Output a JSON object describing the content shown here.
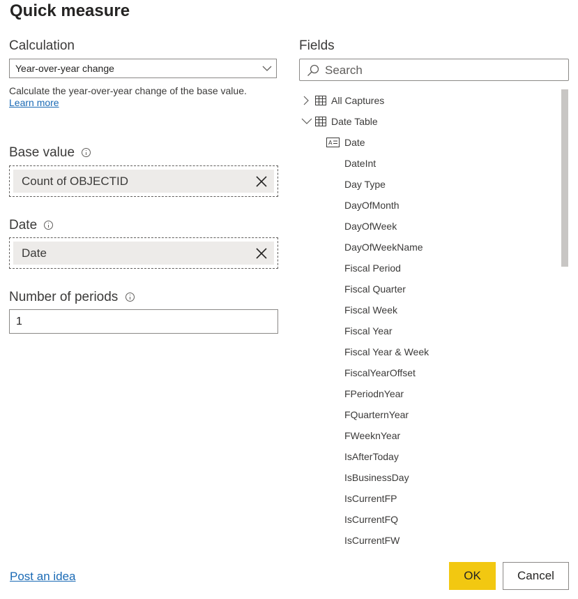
{
  "dialog": {
    "title": "Quick measure"
  },
  "calculation": {
    "label": "Calculation",
    "selected": "Year-over-year change",
    "description": "Calculate the year-over-year change of the base value.",
    "learn_more": "Learn more"
  },
  "base_value": {
    "label": "Base value",
    "value": "Count of OBJECTID"
  },
  "date": {
    "label": "Date",
    "value": "Date"
  },
  "periods": {
    "label": "Number of periods",
    "value": "1"
  },
  "fields": {
    "label": "Fields",
    "search_placeholder": "Search",
    "tables": [
      {
        "name": "All Captures",
        "expanded": false
      },
      {
        "name": "Date Table",
        "expanded": true
      }
    ],
    "date_table_fields": [
      "Date",
      "DateInt",
      "Day Type",
      "DayOfMonth",
      "DayOfWeek",
      "DayOfWeekName",
      "Fiscal Period",
      "Fiscal Quarter",
      "Fiscal Week",
      "Fiscal Year",
      "Fiscal Year & Week",
      "FiscalYearOffset",
      "FPeriodnYear",
      "FQuarternYear",
      "FWeeknYear",
      "IsAfterToday",
      "IsBusinessDay",
      "IsCurrentFP",
      "IsCurrentFQ",
      "IsCurrentFW"
    ]
  },
  "footer": {
    "post_idea": "Post an idea",
    "ok": "OK",
    "cancel": "Cancel"
  },
  "colors": {
    "ok_button": "#f2c811",
    "link": "#1a6ab5",
    "pill_bg": "#edebe9"
  }
}
